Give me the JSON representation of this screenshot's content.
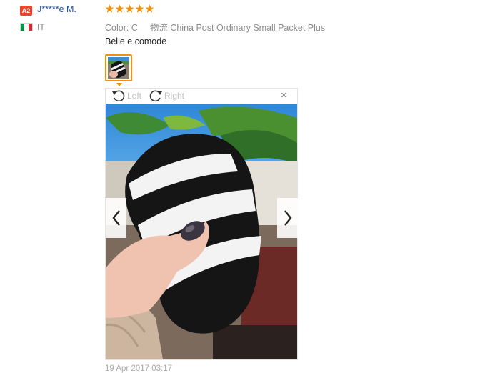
{
  "reviewer": {
    "level_badge": "A2",
    "name": "J*****e M.",
    "country": "IT",
    "flag_colors": [
      "#009246",
      "#ffffff",
      "#ce2b37"
    ]
  },
  "review": {
    "rating_stars": 5,
    "star_color": "#f5900a",
    "color_label": "Color:",
    "color_value": "C",
    "shipping_label": "物流",
    "shipping_value": "China Post Ordinary Small Packet Plus",
    "text": "Belle e comode",
    "date": "19 Apr 2017 03:17"
  },
  "viewer": {
    "rotate_left_label": "Left",
    "rotate_right_label": "Right",
    "close_symbol": "×",
    "image_description_icon": "photo-socks-striped"
  }
}
